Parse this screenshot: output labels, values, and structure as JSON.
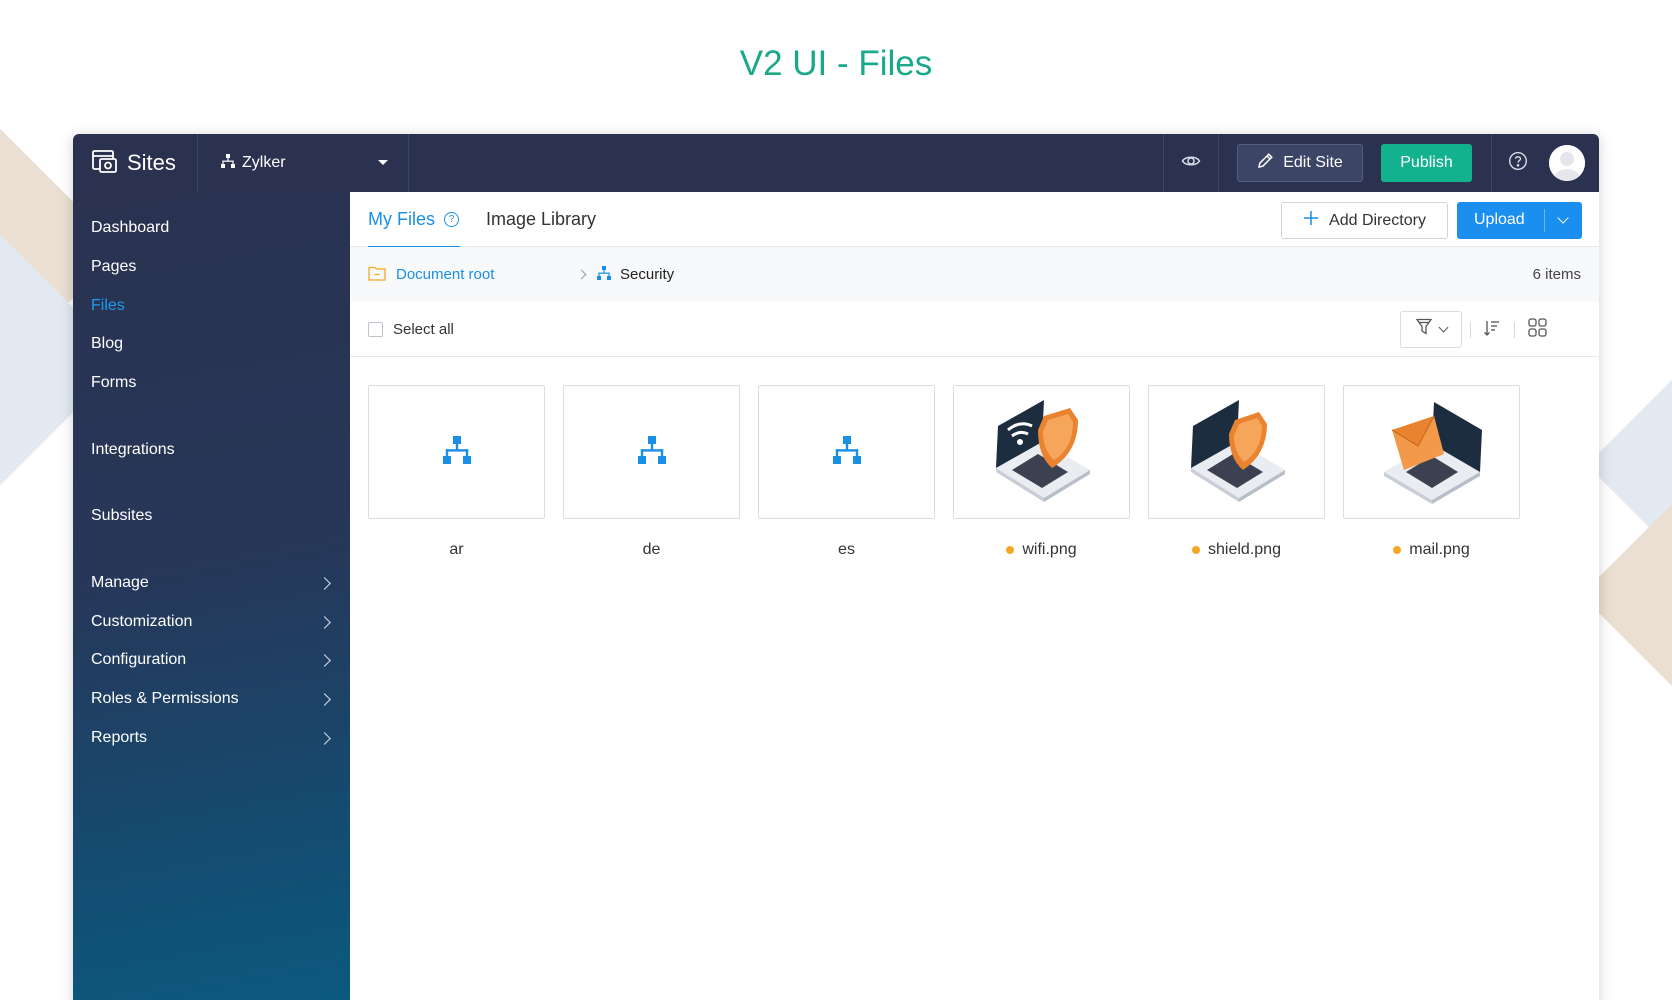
{
  "page_title": "V2 UI - Files",
  "topbar": {
    "brand": "Sites",
    "site_name": "Zylker",
    "edit_label": "Edit Site",
    "publish_label": "Publish"
  },
  "sidebar": {
    "items": [
      {
        "label": "Dashboard",
        "active": false,
        "submenu": false
      },
      {
        "label": "Pages",
        "active": false,
        "submenu": false
      },
      {
        "label": "Files",
        "active": true,
        "submenu": false
      },
      {
        "label": "Blog",
        "active": false,
        "submenu": false
      },
      {
        "label": "Forms",
        "active": false,
        "submenu": false
      },
      {
        "label": "Integrations",
        "active": false,
        "submenu": false
      },
      {
        "label": "Subsites",
        "active": false,
        "submenu": false
      },
      {
        "label": "Manage",
        "active": false,
        "submenu": true
      },
      {
        "label": "Customization",
        "active": false,
        "submenu": true
      },
      {
        "label": "Configuration",
        "active": false,
        "submenu": true
      },
      {
        "label": "Roles & Permissions",
        "active": false,
        "submenu": true
      },
      {
        "label": "Reports",
        "active": false,
        "submenu": true
      }
    ]
  },
  "tabs": {
    "my_files": "My Files",
    "image_library": "Image Library"
  },
  "actions": {
    "add_directory": "Add Directory",
    "upload": "Upload"
  },
  "breadcrumb": {
    "root": "Document root",
    "current": "Security",
    "count": "6 items"
  },
  "toolbar": {
    "select_all": "Select all"
  },
  "files": [
    {
      "name": "ar",
      "type": "directory",
      "icon": "sitemap-icon"
    },
    {
      "name": "de",
      "type": "directory",
      "icon": "sitemap-icon"
    },
    {
      "name": "es",
      "type": "directory",
      "icon": "sitemap-icon"
    },
    {
      "name": "wifi.png",
      "type": "image",
      "icon": "laptop-wifi-shield-image",
      "status_color": "#f5a623"
    },
    {
      "name": "shield.png",
      "type": "image",
      "icon": "laptop-shield-image",
      "status_color": "#f5a623"
    },
    {
      "name": "mail.png",
      "type": "image",
      "icon": "laptop-mail-image",
      "status_color": "#f5a623"
    }
  ],
  "colors": {
    "accent": "#1a8fe6",
    "title_green": "#1aa88b",
    "publish_green": "#12b28f",
    "topbar": "#2a3250"
  }
}
